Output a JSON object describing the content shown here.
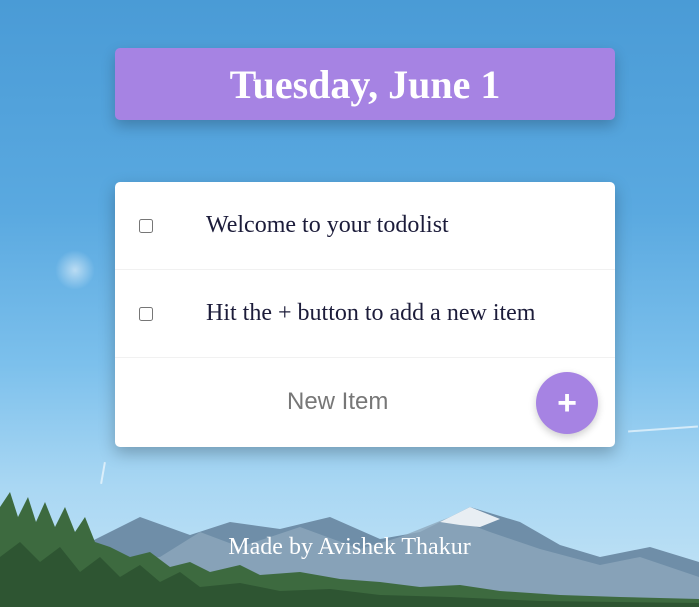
{
  "heading": {
    "title": "Tuesday, June 1"
  },
  "items": [
    {
      "text": "Welcome to your todolist",
      "checked": false
    },
    {
      "text": "Hit the + button to add a new item",
      "checked": false
    }
  ],
  "form": {
    "placeholder": "New Item",
    "add_label": "+"
  },
  "footer": {
    "text": "Made by Avishek Thakur"
  },
  "colors": {
    "accent": "#a683e3",
    "sky": "#5aa9e0"
  }
}
